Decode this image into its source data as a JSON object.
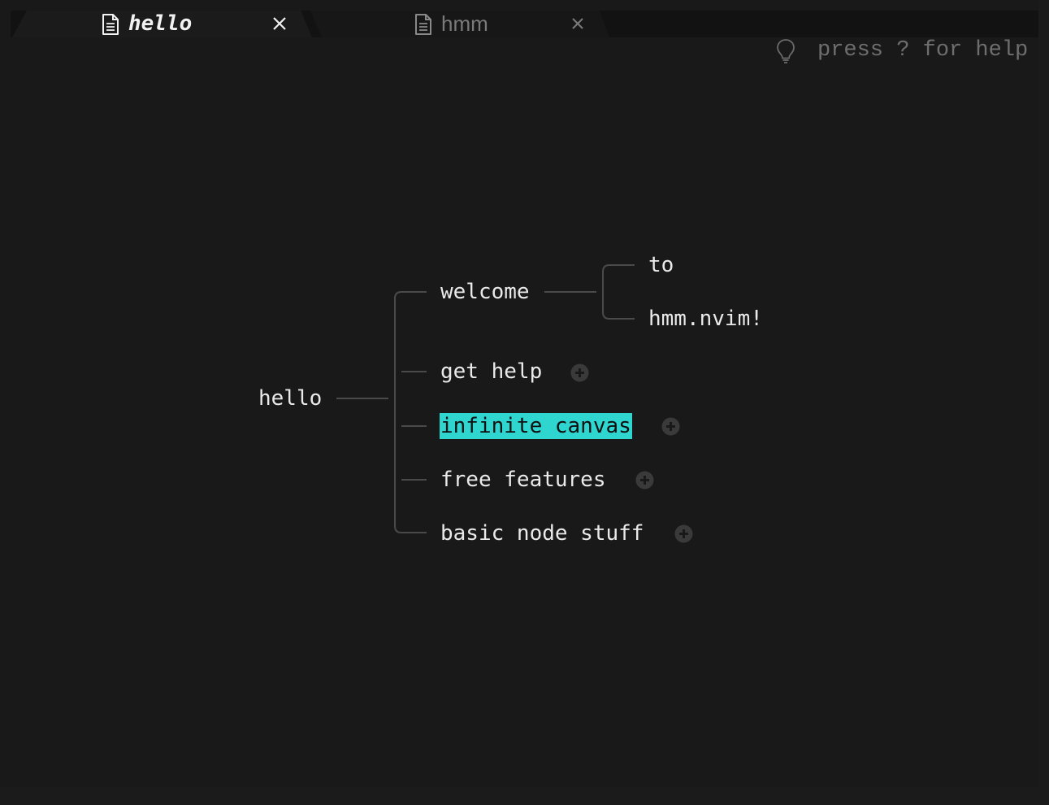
{
  "tabs": [
    {
      "label": "hello",
      "active": true,
      "icon": "file-icon"
    },
    {
      "label": "hmm",
      "active": false,
      "icon": "file-icon"
    }
  ],
  "help_hint": {
    "icon": "lightbulb-icon",
    "text": "press ? for help"
  },
  "mindmap": {
    "root": "hello",
    "welcome": {
      "label": "welcome",
      "children": [
        "to",
        "hmm.nvim!"
      ]
    },
    "branches": [
      {
        "label": "get help",
        "collapsed": true
      },
      {
        "label": "infinite canvas",
        "collapsed": true,
        "selected": true
      },
      {
        "label": "free features",
        "collapsed": true
      },
      {
        "label": "basic node stuff",
        "collapsed": true
      }
    ]
  },
  "colors": {
    "background": "#191919",
    "tabbar": "#121212",
    "active_tab_text": "#f2f2f2",
    "inactive_tab_text": "#7a7a7a",
    "node_text": "#eaeaea",
    "selection": "#2fd5cf",
    "edge": "#4a4a4a",
    "expand_icon": "#3a3a3a"
  }
}
